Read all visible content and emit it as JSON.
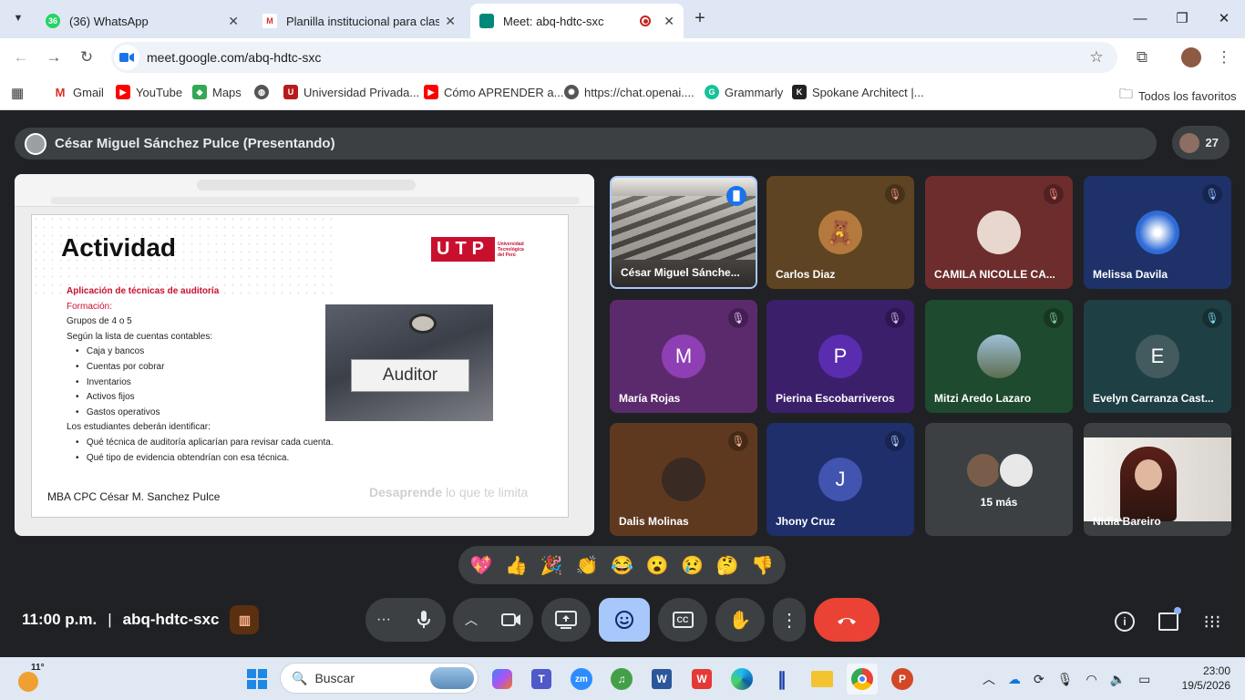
{
  "browser": {
    "tabs": [
      {
        "title": "(36) WhatsApp",
        "badge": "36"
      },
      {
        "title": "Planilla institucional para clase d"
      },
      {
        "title": "Meet: abq-hdtc-sxc"
      }
    ],
    "url": "meet.google.com/abq-hdtc-sxc",
    "bookmarks": [
      "Gmail",
      "YouTube",
      "Maps",
      "Universidad Privada...",
      "Cómo APRENDER a...",
      "https://chat.openai....",
      "Grammarly",
      "Spokane Architect |..."
    ],
    "all_bookmarks_label": "Todos los favoritos"
  },
  "meet": {
    "presenter": "César Miguel Sánchez Pulce (Presentando)",
    "participant_count": "27",
    "meeting_time": "11:00 p.m.",
    "separator": "|",
    "meeting_code": "abq-hdtc-sxc",
    "more_count": "15 más",
    "tiles": [
      {
        "name": "César Miguel Sánche...",
        "kind": "video"
      },
      {
        "name": "Carlos Diaz",
        "kind": "avatar-image",
        "color": "#5e4422"
      },
      {
        "name": "CAMILA NICOLLE CA...",
        "kind": "avatar-image",
        "color": "#6d2d2d"
      },
      {
        "name": "Melissa Davila",
        "kind": "avatar-image",
        "color": "#1e3269"
      },
      {
        "name": "María Rojas",
        "kind": "letter",
        "letter": "M",
        "color": "#5b2a6d",
        "circle": "#8e3fb3"
      },
      {
        "name": "Pierina Escobarriveros",
        "kind": "letter",
        "letter": "P",
        "color": "#3c1f6b",
        "circle": "#5a2cb0"
      },
      {
        "name": "Mitzi Aredo Lazaro",
        "kind": "avatar-image",
        "color": "#1e4a2f"
      },
      {
        "name": "Evelyn Carranza Cast...",
        "kind": "letter",
        "letter": "E",
        "color": "#1e3f44",
        "circle": "#435a5f"
      },
      {
        "name": "Dalis Molinas",
        "kind": "avatar-image",
        "color": "#5e3920"
      },
      {
        "name": "Jhony Cruz",
        "kind": "letter",
        "letter": "J",
        "color": "#1f2f6b",
        "circle": "#4054b0"
      },
      {
        "name": "15 más",
        "kind": "more",
        "color": "#3c4043"
      },
      {
        "name": "Nidia Bareiro",
        "kind": "video-self",
        "color": "#3c4043"
      }
    ],
    "reactions": [
      "💖",
      "👍",
      "🎉",
      "👏",
      "😂",
      "😮",
      "😢",
      "🤔",
      "👎"
    ]
  },
  "slide": {
    "title": "Actividad",
    "logo": "UTP",
    "logo_sub": [
      "Universidad",
      "Tecnológica",
      "del Perú"
    ],
    "subtitle": "Aplicación de técnicas de auditoría",
    "formation": "Formación:",
    "lines": [
      "Grupos de 4 o 5",
      "Según la lista de cuentas contables:"
    ],
    "accounts": [
      "Caja y bancos",
      "Cuentas por cobrar",
      "Inventarios",
      "Activos fijos",
      "Gastos operativos"
    ],
    "students_line": "Los estudiantes deberán identificar:",
    "questions": [
      "Qué técnica de auditoría aplicarían para revisar cada cuenta.",
      "Qué tipo de evidencia obtendrían con esa técnica."
    ],
    "image_label": "Auditor",
    "footer_left": "MBA CPC César M. Sanchez Pulce",
    "footer_right_bold": "Desaprende",
    "footer_right_rest": " lo que te limita"
  },
  "taskbar": {
    "weather": "11°",
    "search_placeholder": "Buscar",
    "time": "23:00",
    "date": "19/5/2026"
  },
  "colors": {
    "meet_bg": "#202124",
    "end_call": "#ea4335",
    "active_control": "#a8c7fa",
    "utp_red": "#c8102e"
  }
}
